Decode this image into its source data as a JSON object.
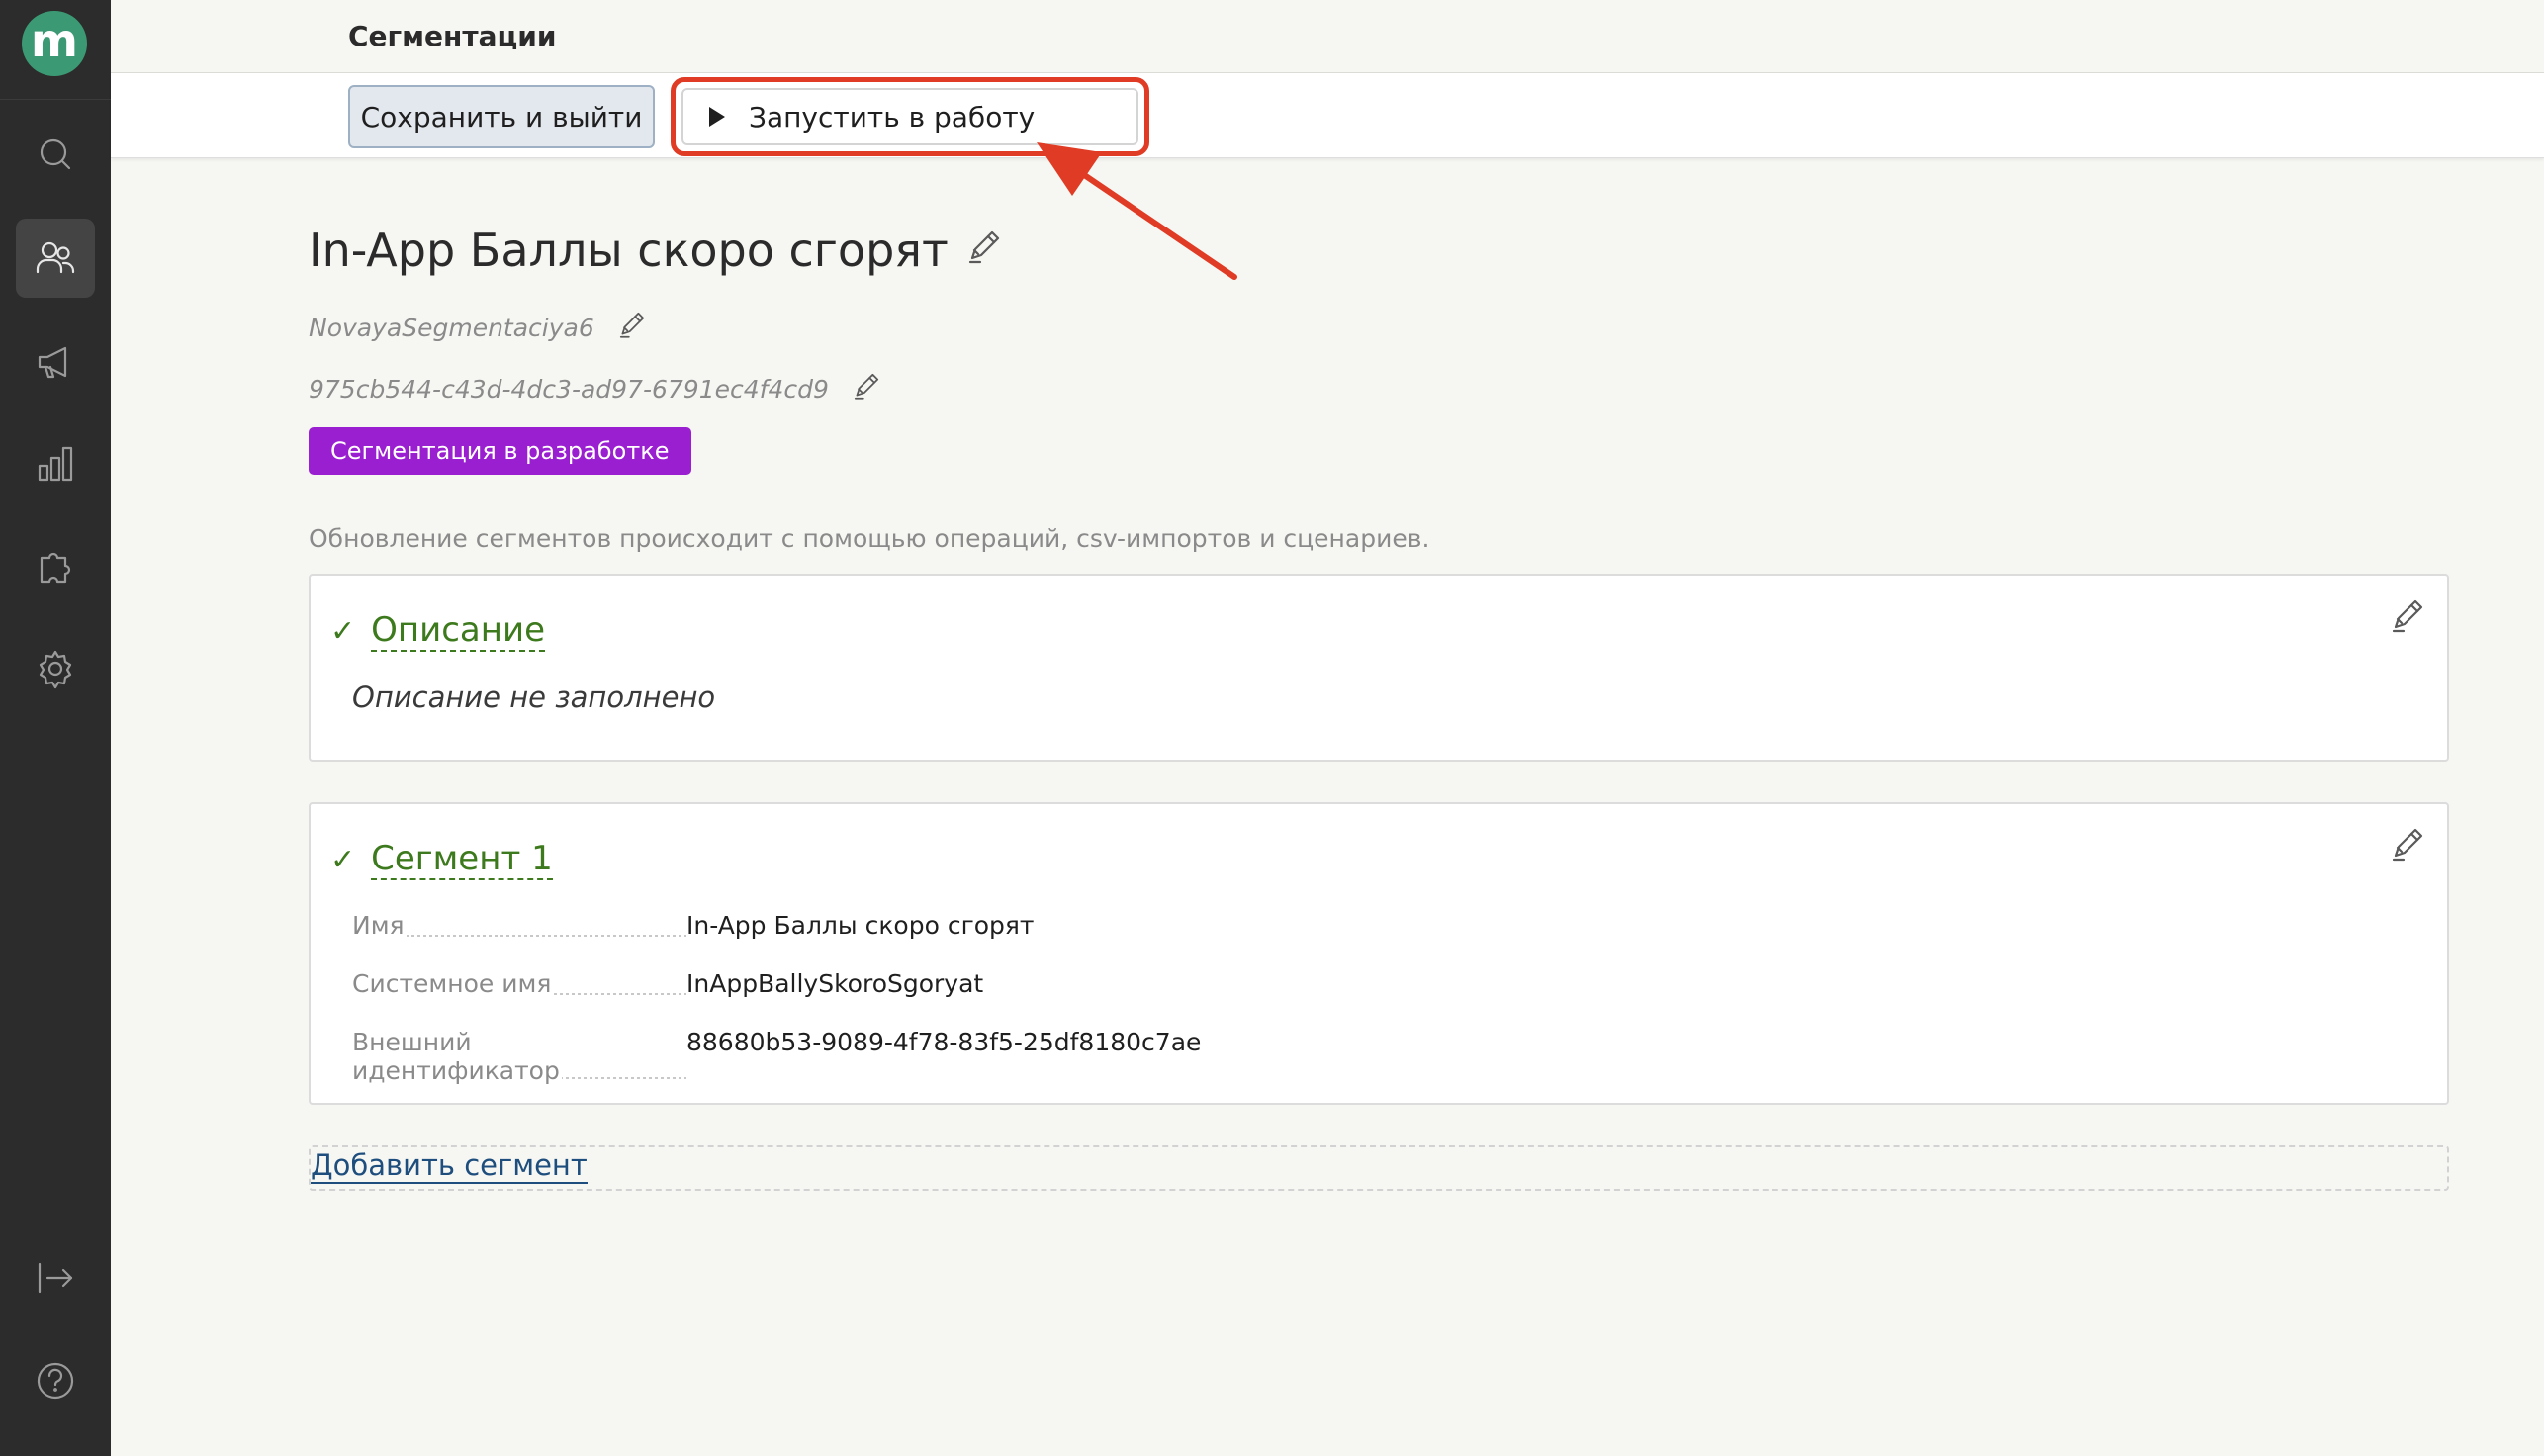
{
  "sidebar": {
    "logo_letter": "m",
    "items": [
      {
        "name": "search",
        "icon": "search-icon"
      },
      {
        "name": "users",
        "icon": "users-icon",
        "active": true
      },
      {
        "name": "campaigns",
        "icon": "megaphone-icon"
      },
      {
        "name": "analytics",
        "icon": "bar-chart-icon"
      },
      {
        "name": "integrations",
        "icon": "puzzle-icon"
      },
      {
        "name": "settings",
        "icon": "gear-icon"
      }
    ],
    "bottom_items": [
      {
        "name": "logout",
        "icon": "logout-icon"
      },
      {
        "name": "help",
        "icon": "help-icon"
      }
    ],
    "accent_color": "#3b9a74"
  },
  "header": {
    "title": "Сегментации"
  },
  "toolbar": {
    "save_label": "Сохранить и выйти",
    "run_label": "Запустить в работу",
    "highlight_color": "#e03b24"
  },
  "segmentation": {
    "title": "In-App Баллы скоро сгорят",
    "system_name": "NovayaSegmentaciya6",
    "id": "975cb544-c43d-4dc3-ad97-6791ec4f4cd9",
    "status": "Сегментация в разработке",
    "status_color": "#9a1fd0",
    "info": "Обновление сегментов происходит с помощью операций, csv-импортов и сценариев."
  },
  "description_card": {
    "title": "Описание",
    "empty_text": "Описание не заполнено"
  },
  "segment_card": {
    "title": "Сегмент 1",
    "fields": [
      {
        "label": "Имя",
        "value": "In-App Баллы скоро сгорят"
      },
      {
        "label": "Системное имя",
        "value": "InAppBallySkoroSgoryat"
      },
      {
        "label": "Внешний идентификатор",
        "value": "88680b53-9089-4f78-83f5-25df8180c7ae"
      }
    ]
  },
  "add_segment_label": "Добавить сегмент"
}
